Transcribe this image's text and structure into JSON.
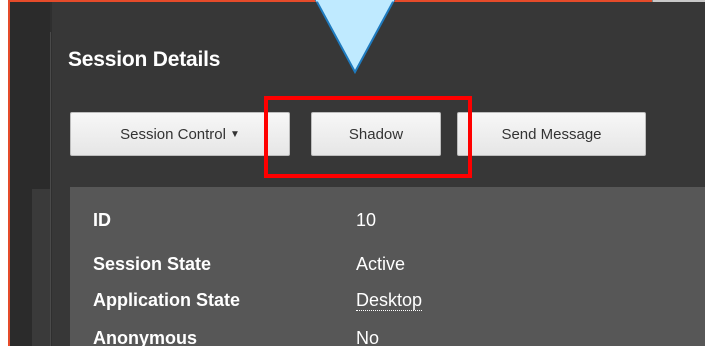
{
  "panel": {
    "title": "Session Details"
  },
  "toolbar": {
    "session_control_label": "Session Control",
    "shadow_label": "Shadow",
    "send_message_label": "Send Message"
  },
  "details": {
    "rows": [
      {
        "label": "ID",
        "value": "10"
      },
      {
        "label": "Session State",
        "value": "Active"
      },
      {
        "label": "Application State",
        "value": "Desktop"
      },
      {
        "label": "Anonymous",
        "value": "No"
      }
    ]
  },
  "colors": {
    "highlight": "#ff0000",
    "callout_fill": "#bfeaff",
    "callout_stroke": "#1f7bbf",
    "panel_bg": "#373737",
    "details_bg": "#575757"
  },
  "icons": {
    "dropdown": "caret-down-icon"
  }
}
